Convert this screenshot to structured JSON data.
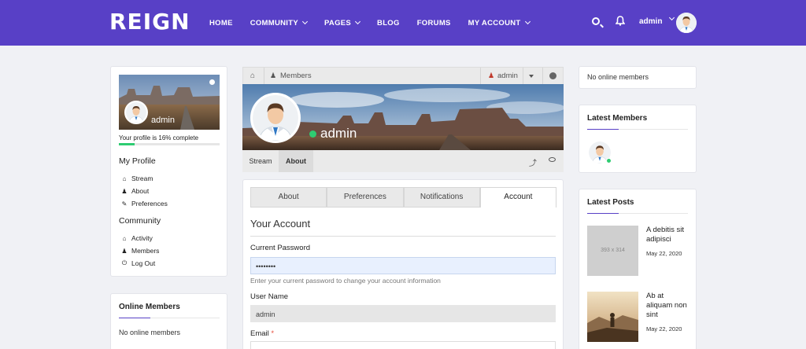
{
  "header": {
    "logo": "REIGN",
    "nav": [
      {
        "label": "HOME",
        "dropdown": false
      },
      {
        "label": "COMMUNITY",
        "dropdown": true
      },
      {
        "label": "PAGES",
        "dropdown": true
      },
      {
        "label": "BLOG",
        "dropdown": false
      },
      {
        "label": "FORUMS",
        "dropdown": false
      },
      {
        "label": "MY ACCOUNT",
        "dropdown": true
      }
    ],
    "user_name": "admin",
    "accent": "#5840c6"
  },
  "left_sidebar": {
    "profile_name": "admin",
    "progress_text": "Your profile is 16% complete",
    "progress_value": 0.16,
    "my_profile_title": "My Profile",
    "my_profile_items": [
      {
        "label": "Stream",
        "icon": "home-icon"
      },
      {
        "label": "About",
        "icon": "user-icon"
      },
      {
        "label": "Preferences",
        "icon": "edit-icon"
      }
    ],
    "community_title": "Community",
    "community_items": [
      {
        "label": "Activity",
        "icon": "home-icon"
      },
      {
        "label": "Members",
        "icon": "members-icon"
      },
      {
        "label": "Log Out",
        "icon": "power-icon"
      }
    ],
    "online_members_title": "Online Members",
    "online_members_text": "No online members"
  },
  "breadcrumb": {
    "members_label": "Members",
    "user_label": "admin"
  },
  "cover": {
    "name": "admin"
  },
  "subtabs": [
    {
      "label": "Stream",
      "active": false
    },
    {
      "label": "About",
      "active": true
    }
  ],
  "account": {
    "tabs": [
      {
        "label": "About",
        "active": false
      },
      {
        "label": "Preferences",
        "active": false
      },
      {
        "label": "Notifications",
        "active": false
      },
      {
        "label": "Account",
        "active": true
      }
    ],
    "title": "Your Account",
    "current_password_label": "Current Password",
    "current_password_value": "••••••••",
    "password_hint": "Enter your current password to change your account information",
    "username_label": "User Name",
    "username_value": "admin",
    "email_label": "Email",
    "email_required": "*"
  },
  "right_sidebar": {
    "online_text": "No online members",
    "latest_members_title": "Latest Members",
    "latest_posts_title": "Latest Posts",
    "posts": [
      {
        "title": "A debitis sit adipisci",
        "date": "May 22, 2020",
        "placeholder": "393 x 314"
      },
      {
        "title": "Ab at aliquam non sint",
        "date": "May 22, 2020"
      }
    ]
  }
}
